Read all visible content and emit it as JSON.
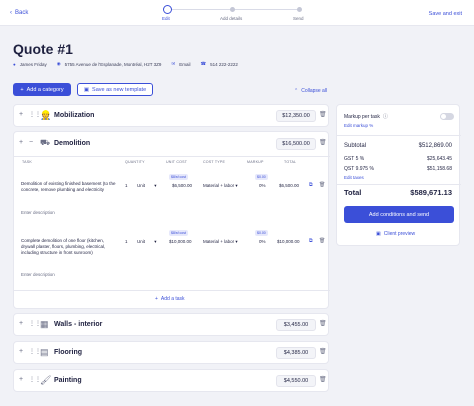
{
  "topbar": {
    "back_label": "Back",
    "steps": [
      "Edit",
      "Add details",
      "Send"
    ],
    "save_exit_label": "Save and exit"
  },
  "quote": {
    "title": "Quote #1",
    "client": "James Friday",
    "address": "5755 Avenue de l'Esplanade, Montréal, H2T 3Z9",
    "email_label": "Email",
    "phone": "514 222-2222"
  },
  "actions": {
    "add_category": "Add a category",
    "save_template": "Save as new template",
    "collapse_all": "Collapse all"
  },
  "categories": {
    "mobilization": {
      "name": "Mobilization",
      "total": "$12,350.00"
    },
    "demolition": {
      "name": "Demolition",
      "total": "$16,500.00"
    },
    "walls": {
      "name": "Walls - interior",
      "total": "$3,455.00"
    },
    "flooring": {
      "name": "Flooring",
      "total": "$4,385.00"
    },
    "painting": {
      "name": "Painting",
      "total": "$4,550.00"
    }
  },
  "table": {
    "headers": [
      "TASK",
      "QUANTITY",
      "UNIT COST",
      "COST TYPE",
      "MARKUP",
      "TOTAL"
    ],
    "rows": [
      {
        "task": "Demolition of existing finished basement (to the concrete, remove plumbing and electricity",
        "desc_placeholder": "Enter description",
        "qty": "1",
        "unit": "Unit",
        "tag": "$8/sf cost",
        "unit_cost": "$6,500.00",
        "cost_type": "Material + labor",
        "markup_tag": "$0.00",
        "markup": "0%",
        "total": "$6,500.00"
      },
      {
        "task": "Complete demolition of one floor (kitchen, drywall plaster, floors, plumbing, electrical, including structure in front sunroom)",
        "desc_placeholder": "Enter description",
        "qty": "1",
        "unit": "Unit",
        "tag": "$8/sf cost",
        "unit_cost": "$10,000.00",
        "cost_type": "Material + labor",
        "markup_tag": "$0.00",
        "markup": "0%",
        "total": "$10,000.00"
      }
    ],
    "add_task": "Add a task"
  },
  "summary": {
    "markup_label": "Markup per task",
    "edit_markup": "Edit markup %",
    "subtotal_label": "Subtotal",
    "subtotal": "$512,869.00",
    "gst_label": "GST 5 %",
    "gst": "$25,643.45",
    "qst_label": "QST 9.975 %",
    "qst": "$51,158.68",
    "edit_taxes": "Edit taxes",
    "total_label": "Total",
    "total": "$589,671.13",
    "add_conditions": "Add conditions and send",
    "client_preview": "Client preview"
  },
  "colors": {
    "accent": "#3b4fd8",
    "background": "#f1f2f7"
  }
}
